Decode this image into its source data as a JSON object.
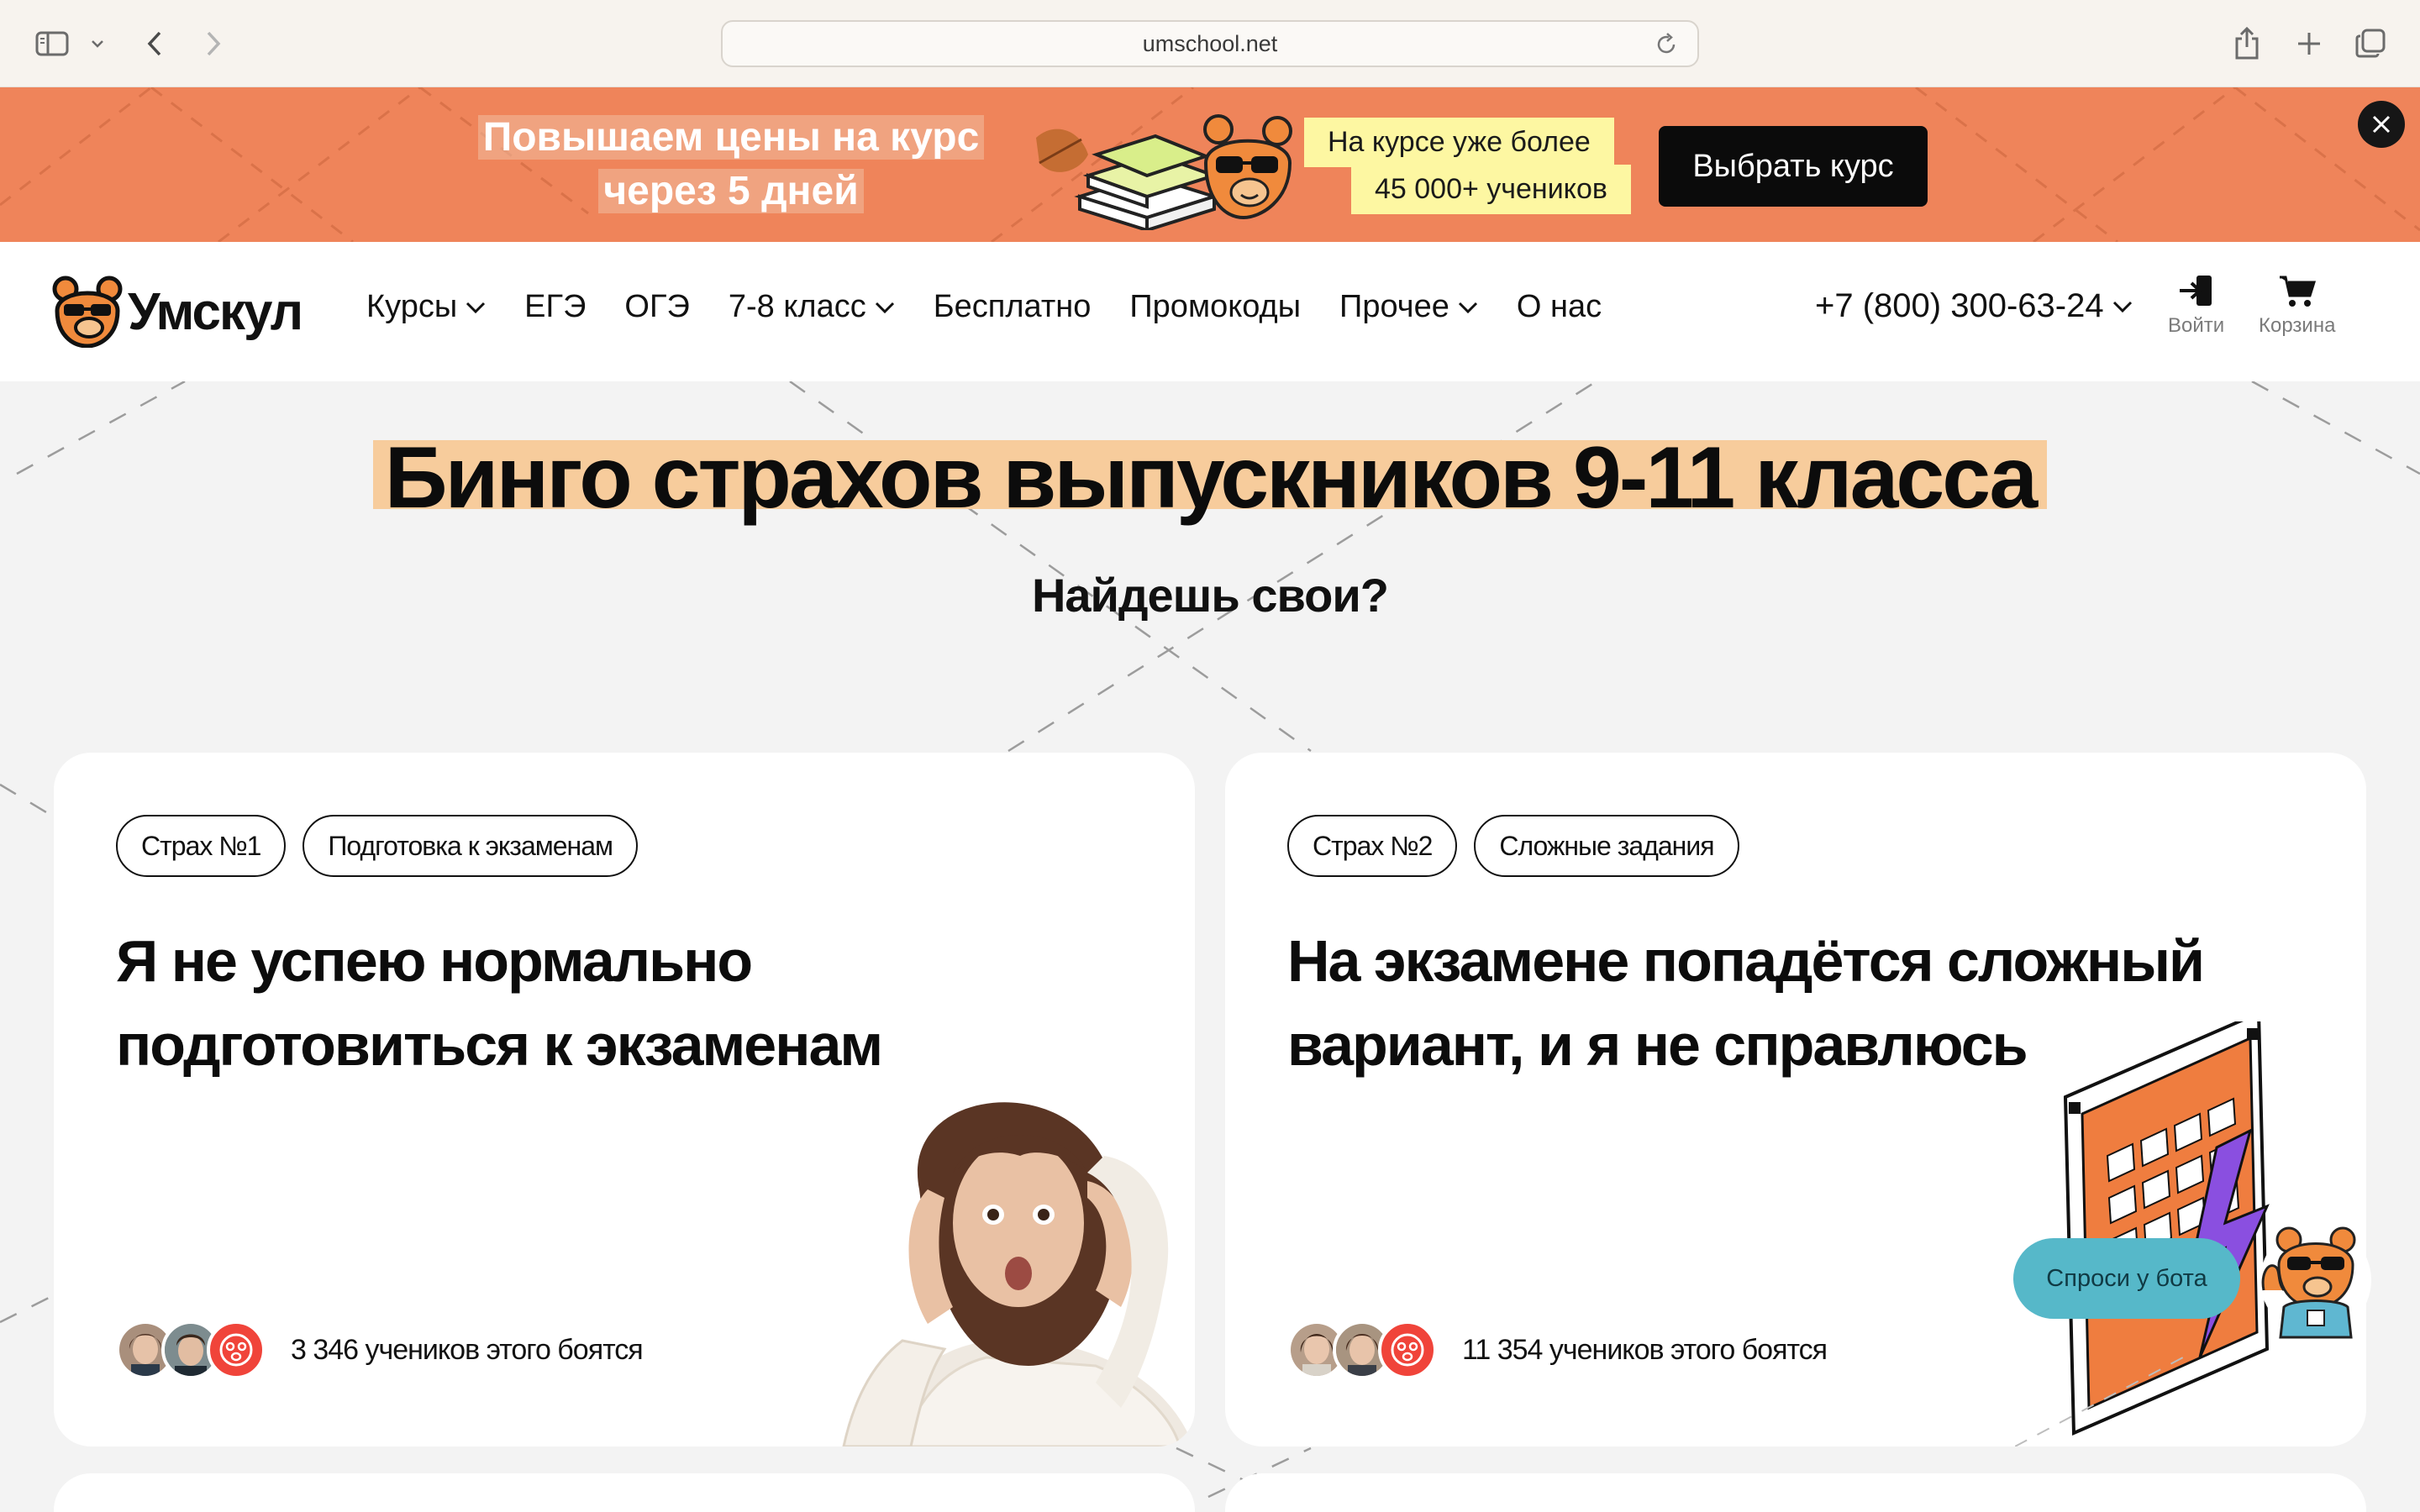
{
  "browser": {
    "url": "umschool.net"
  },
  "banner": {
    "line1": "Повышаем цены на курс",
    "line2": "через 5 дней",
    "stat_line1": "На курсе уже более",
    "stat_line2": "45 000+ учеников",
    "cta": "Выбрать курс"
  },
  "nav": {
    "logo": "Умскул",
    "items": [
      "Курсы",
      "ЕГЭ",
      "ОГЭ",
      "7-8 класс",
      "Бесплатно",
      "Промокоды",
      "Прочее",
      "О нас"
    ],
    "phone": "+7 (800) 300-63-24",
    "login": "Войти",
    "cart": "Корзина"
  },
  "hero": {
    "title": "Бинго страхов выпускников 9-11 класса",
    "subtitle": "Найдешь свои?"
  },
  "cards": [
    {
      "tag1": "Страх №1",
      "tag2": "Подготовка к экзаменам",
      "title_line1": "Я не успею нормально",
      "title_line2": "подготовиться к экзаменам",
      "count": "3 346 учеников этого боятся"
    },
    {
      "tag1": "Страх №2",
      "tag2": "Сложные задания",
      "title_line1": "На экзамене попадётся сложный",
      "title_line2": "вариант, и я не справлюсь",
      "count": "11 354 учеников этого боятся"
    }
  ],
  "bot": {
    "label": "Спроси у бота"
  },
  "colors": {
    "banner": "#ef845a",
    "highlight": "#f7cc9c",
    "stat": "#fdf7a2",
    "bot": "#56b8c9",
    "accent_red": "#f0443a"
  }
}
